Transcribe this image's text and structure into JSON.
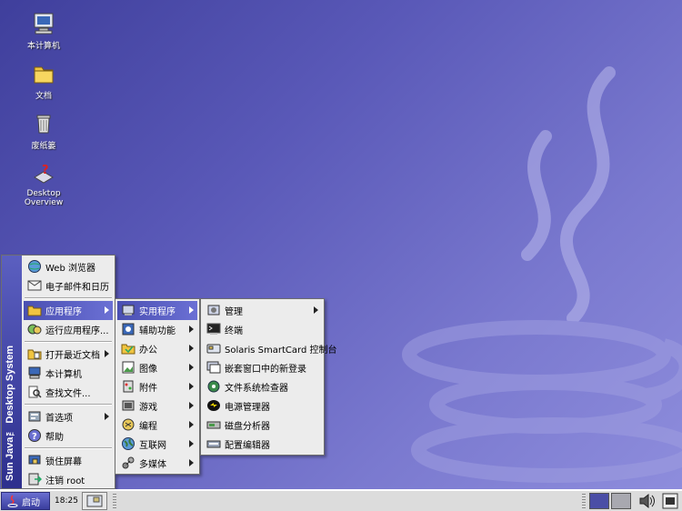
{
  "desktop": {
    "icons": [
      {
        "label": "本计算机",
        "icon": "computer-icon"
      },
      {
        "label": "文档",
        "icon": "folder-icon"
      },
      {
        "label": "废纸篓",
        "icon": "trash-icon"
      },
      {
        "label": "Desktop Overview",
        "icon": "help-overview-icon"
      }
    ]
  },
  "launch_menu": {
    "banner": "Sun Java™ Desktop System",
    "items": [
      {
        "label": "Web 浏览器",
        "icon": "web-browser-icon"
      },
      {
        "label": "电子邮件和日历",
        "icon": "mail-icon"
      },
      {
        "label": "应用程序",
        "icon": "applications-icon",
        "submenu": true,
        "selected": true
      },
      {
        "label": "运行应用程序...",
        "icon": "run-icon"
      },
      {
        "label": "打开最近文档",
        "icon": "recent-docs-icon",
        "submenu": true
      },
      {
        "label": "本计算机",
        "icon": "computer-icon"
      },
      {
        "label": "查找文件...",
        "icon": "find-icon"
      },
      {
        "label": "首选项",
        "icon": "preferences-icon",
        "submenu": true
      },
      {
        "label": "帮助",
        "icon": "help-icon"
      },
      {
        "label": "锁住屏幕",
        "icon": "lock-icon"
      },
      {
        "label": "注销 root",
        "icon": "logout-icon"
      }
    ]
  },
  "applications_menu": {
    "items": [
      {
        "label": "实用程序",
        "icon": "utilities-icon",
        "selected": true
      },
      {
        "label": "辅助功能",
        "icon": "accessibility-icon"
      },
      {
        "label": "办公",
        "icon": "office-icon"
      },
      {
        "label": "图像",
        "icon": "graphics-icon"
      },
      {
        "label": "附件",
        "icon": "accessories-icon"
      },
      {
        "label": "游戏",
        "icon": "games-icon"
      },
      {
        "label": "编程",
        "icon": "programming-icon"
      },
      {
        "label": "互联网",
        "icon": "internet-icon"
      },
      {
        "label": "多媒体",
        "icon": "multimedia-icon"
      }
    ]
  },
  "utilities_menu": {
    "items": [
      {
        "label": "管理",
        "icon": "admin-icon",
        "submenu": true
      },
      {
        "label": "终端",
        "icon": "terminal-icon"
      },
      {
        "label": "Solaris SmartCard 控制台",
        "icon": "smartcard-icon"
      },
      {
        "label": "嵌套窗口中的新登录",
        "icon": "nested-login-icon"
      },
      {
        "label": "文件系统检查器",
        "icon": "fs-check-icon"
      },
      {
        "label": "电源管理器",
        "icon": "power-icon"
      },
      {
        "label": "磁盘分析器",
        "icon": "disk-analyzer-icon"
      },
      {
        "label": "配置编辑器",
        "icon": "config-editor-icon"
      }
    ]
  },
  "taskbar": {
    "launch_label": "启动",
    "clock": "18:25"
  },
  "colors": {
    "desktop_bg": "#5a59b8",
    "menu_bg": "#ececec",
    "selection": "#4a4fb2",
    "banner": "#2d2f8d"
  }
}
